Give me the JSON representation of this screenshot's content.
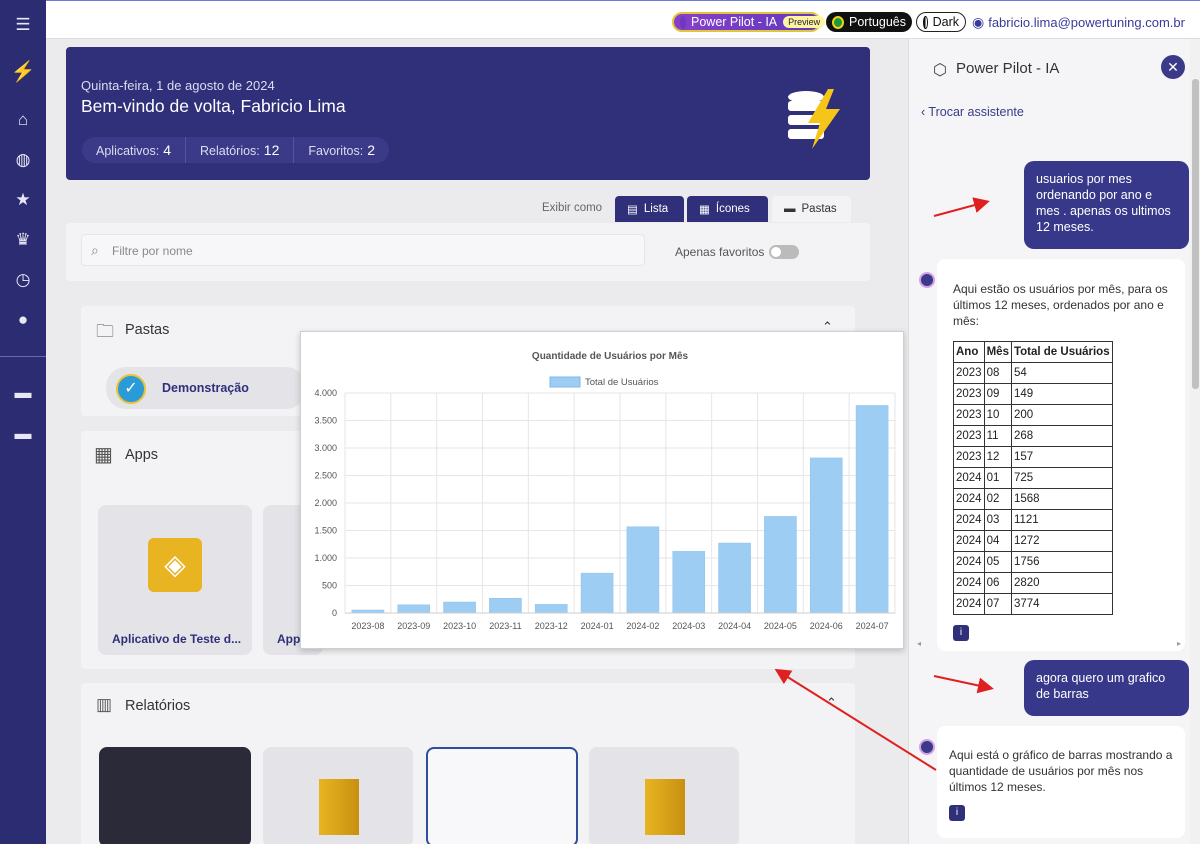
{
  "topbar": {
    "powerpilot_label": "Power Pilot - IA",
    "preview_badge": "Preview",
    "language": "Português",
    "theme": "Dark",
    "user_email": "fabricio.lima@powertuning.com.br"
  },
  "hero": {
    "date": "Quinta-feira, 1 de agosto de 2024",
    "welcome": "Bem-vindo de volta, Fabricio Lima",
    "stats": [
      {
        "label": "Aplicativos:",
        "value": "4"
      },
      {
        "label": "Relatórios:",
        "value": "12"
      },
      {
        "label": "Favoritos:",
        "value": "2"
      }
    ]
  },
  "view": {
    "label": "Exibir como",
    "list": "Lista",
    "icons": "Ícones",
    "folders": "Pastas"
  },
  "search": {
    "placeholder": "Filtre por nome"
  },
  "favorites_only": "Apenas favoritos",
  "sections": {
    "folders": "Pastas",
    "folder_item": "Demonstração",
    "apps": "Apps",
    "app_items": [
      "Aplicativo de Teste d...",
      "App"
    ],
    "reports": "Relatórios"
  },
  "chart_data": {
    "type": "bar",
    "title": "Quantidade de Usuários por Mês",
    "series": [
      {
        "name": "Total de Usuários",
        "values": [
          54,
          149,
          200,
          268,
          157,
          725,
          1568,
          1121,
          1272,
          1756,
          2820,
          3774
        ]
      }
    ],
    "categories": [
      "2023-08",
      "2023-09",
      "2023-10",
      "2023-11",
      "2023-12",
      "2024-01",
      "2024-02",
      "2024-03",
      "2024-04",
      "2024-05",
      "2024-06",
      "2024-07"
    ],
    "ylim": [
      0,
      4000
    ],
    "yticks": [
      "0",
      "500",
      "1.000",
      "1.500",
      "2.000",
      "2.500",
      "3.000",
      "3.500",
      "4.000"
    ],
    "legend": "top",
    "grid": true,
    "color": "#9dcdf2"
  },
  "assistant": {
    "title": "Power Pilot - IA",
    "switch": "Trocar assistente",
    "user_msg1": "usuarios por mes ordenando por ano e mes . apenas os ultimos 12 meses.",
    "bot_msg1": "Aqui estão os usuários por mês, para os últimos 12 meses, ordenados por ano e mês:",
    "table_headers": [
      "Ano",
      "Mês",
      "Total de Usuários"
    ],
    "table_rows": [
      [
        "2023",
        "08",
        "54"
      ],
      [
        "2023",
        "09",
        "149"
      ],
      [
        "2023",
        "10",
        "200"
      ],
      [
        "2023",
        "11",
        "268"
      ],
      [
        "2023",
        "12",
        "157"
      ],
      [
        "2024",
        "01",
        "725"
      ],
      [
        "2024",
        "02",
        "1568"
      ],
      [
        "2024",
        "03",
        "1121"
      ],
      [
        "2024",
        "04",
        "1272"
      ],
      [
        "2024",
        "05",
        "1756"
      ],
      [
        "2024",
        "06",
        "2820"
      ],
      [
        "2024",
        "07",
        "3774"
      ]
    ],
    "user_msg2": "agora quero um grafico de barras",
    "bot_msg2": "Aqui está o gráfico de barras mostrando a quantidade de usuários por mês nos últimos 12 meses."
  }
}
